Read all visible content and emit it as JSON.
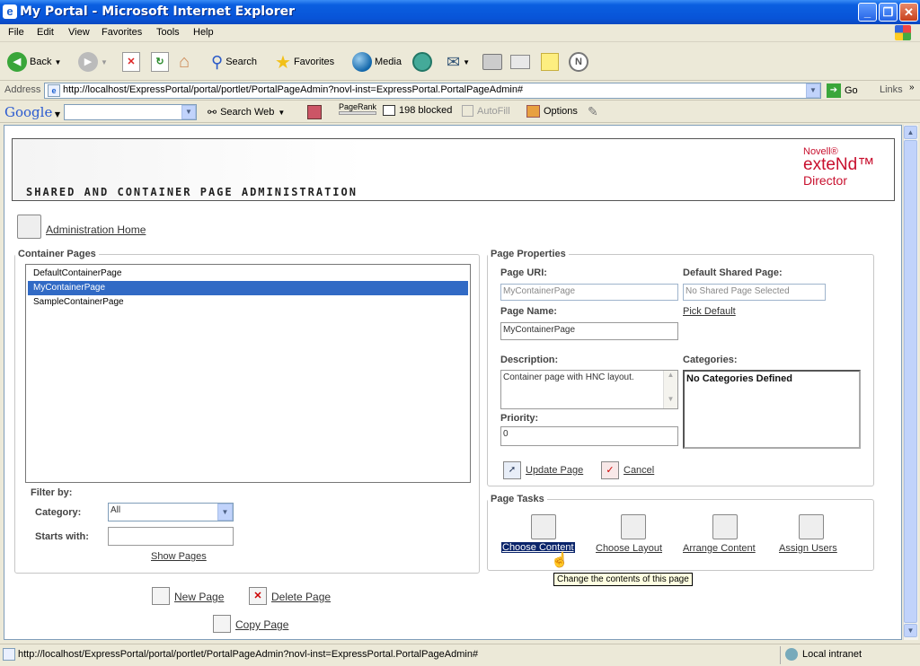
{
  "window": {
    "title": "My Portal - Microsoft Internet Explorer"
  },
  "menu": [
    "File",
    "Edit",
    "View",
    "Favorites",
    "Tools",
    "Help"
  ],
  "toolbar": {
    "back": "Back",
    "search": "Search",
    "favorites": "Favorites",
    "media": "Media"
  },
  "address": {
    "label": "Address",
    "url": "http://localhost/ExpressPortal/portal/portlet/PortalPageAdmin?novl-inst=ExpressPortal.PortalPageAdmin#",
    "go": "Go",
    "links": "Links"
  },
  "google": {
    "logo": "Google",
    "search_web": "Search Web",
    "pagerank": "PageRank",
    "blocked": "198 blocked",
    "autofill": "AutoFill",
    "options": "Options"
  },
  "header": {
    "title": "SHARED AND CONTAINER PAGE ADMINISTRATION",
    "brand1": "Novell®",
    "brand2": "exteNd™",
    "brand3": "Director"
  },
  "admin_home": "Administration Home",
  "container_pages": {
    "legend": "Container Pages",
    "items": [
      "DefaultContainerPage",
      "MyContainerPage",
      "SampleContainerPage"
    ],
    "selected_index": 1,
    "filter_by": "Filter by:",
    "category_label": "Category:",
    "category_value": "All",
    "starts_with_label": "Starts with:",
    "show_pages": "Show Pages"
  },
  "actions": {
    "new_page": "New Page",
    "delete_page": "Delete Page",
    "copy_page": "Copy Page"
  },
  "page_properties": {
    "legend": "Page Properties",
    "uri_label": "Page URI:",
    "uri_value": "MyContainerPage",
    "default_shared_label": "Default Shared Page:",
    "default_shared_value": "No Shared Page Selected",
    "pick_default": "Pick Default",
    "name_label": "Page Name:",
    "name_value": "MyContainerPage",
    "description_label": "Description:",
    "description_value": "Container page with HNC layout.",
    "categories_label": "Categories:",
    "categories_value": "No Categories Defined",
    "priority_label": "Priority:",
    "priority_value": "0",
    "update_page": "Update Page",
    "cancel": "Cancel"
  },
  "page_tasks": {
    "legend": "Page Tasks",
    "choose_content": "Choose Content",
    "choose_layout": "Choose Layout",
    "arrange_content": "Arrange Content",
    "assign_users": "Assign Users",
    "tooltip": "Change the contents of this page"
  },
  "status": {
    "url": "http://localhost/ExpressPortal/portal/portlet/PortalPageAdmin?novl-inst=ExpressPortal.PortalPageAdmin#",
    "zone": "Local intranet"
  }
}
